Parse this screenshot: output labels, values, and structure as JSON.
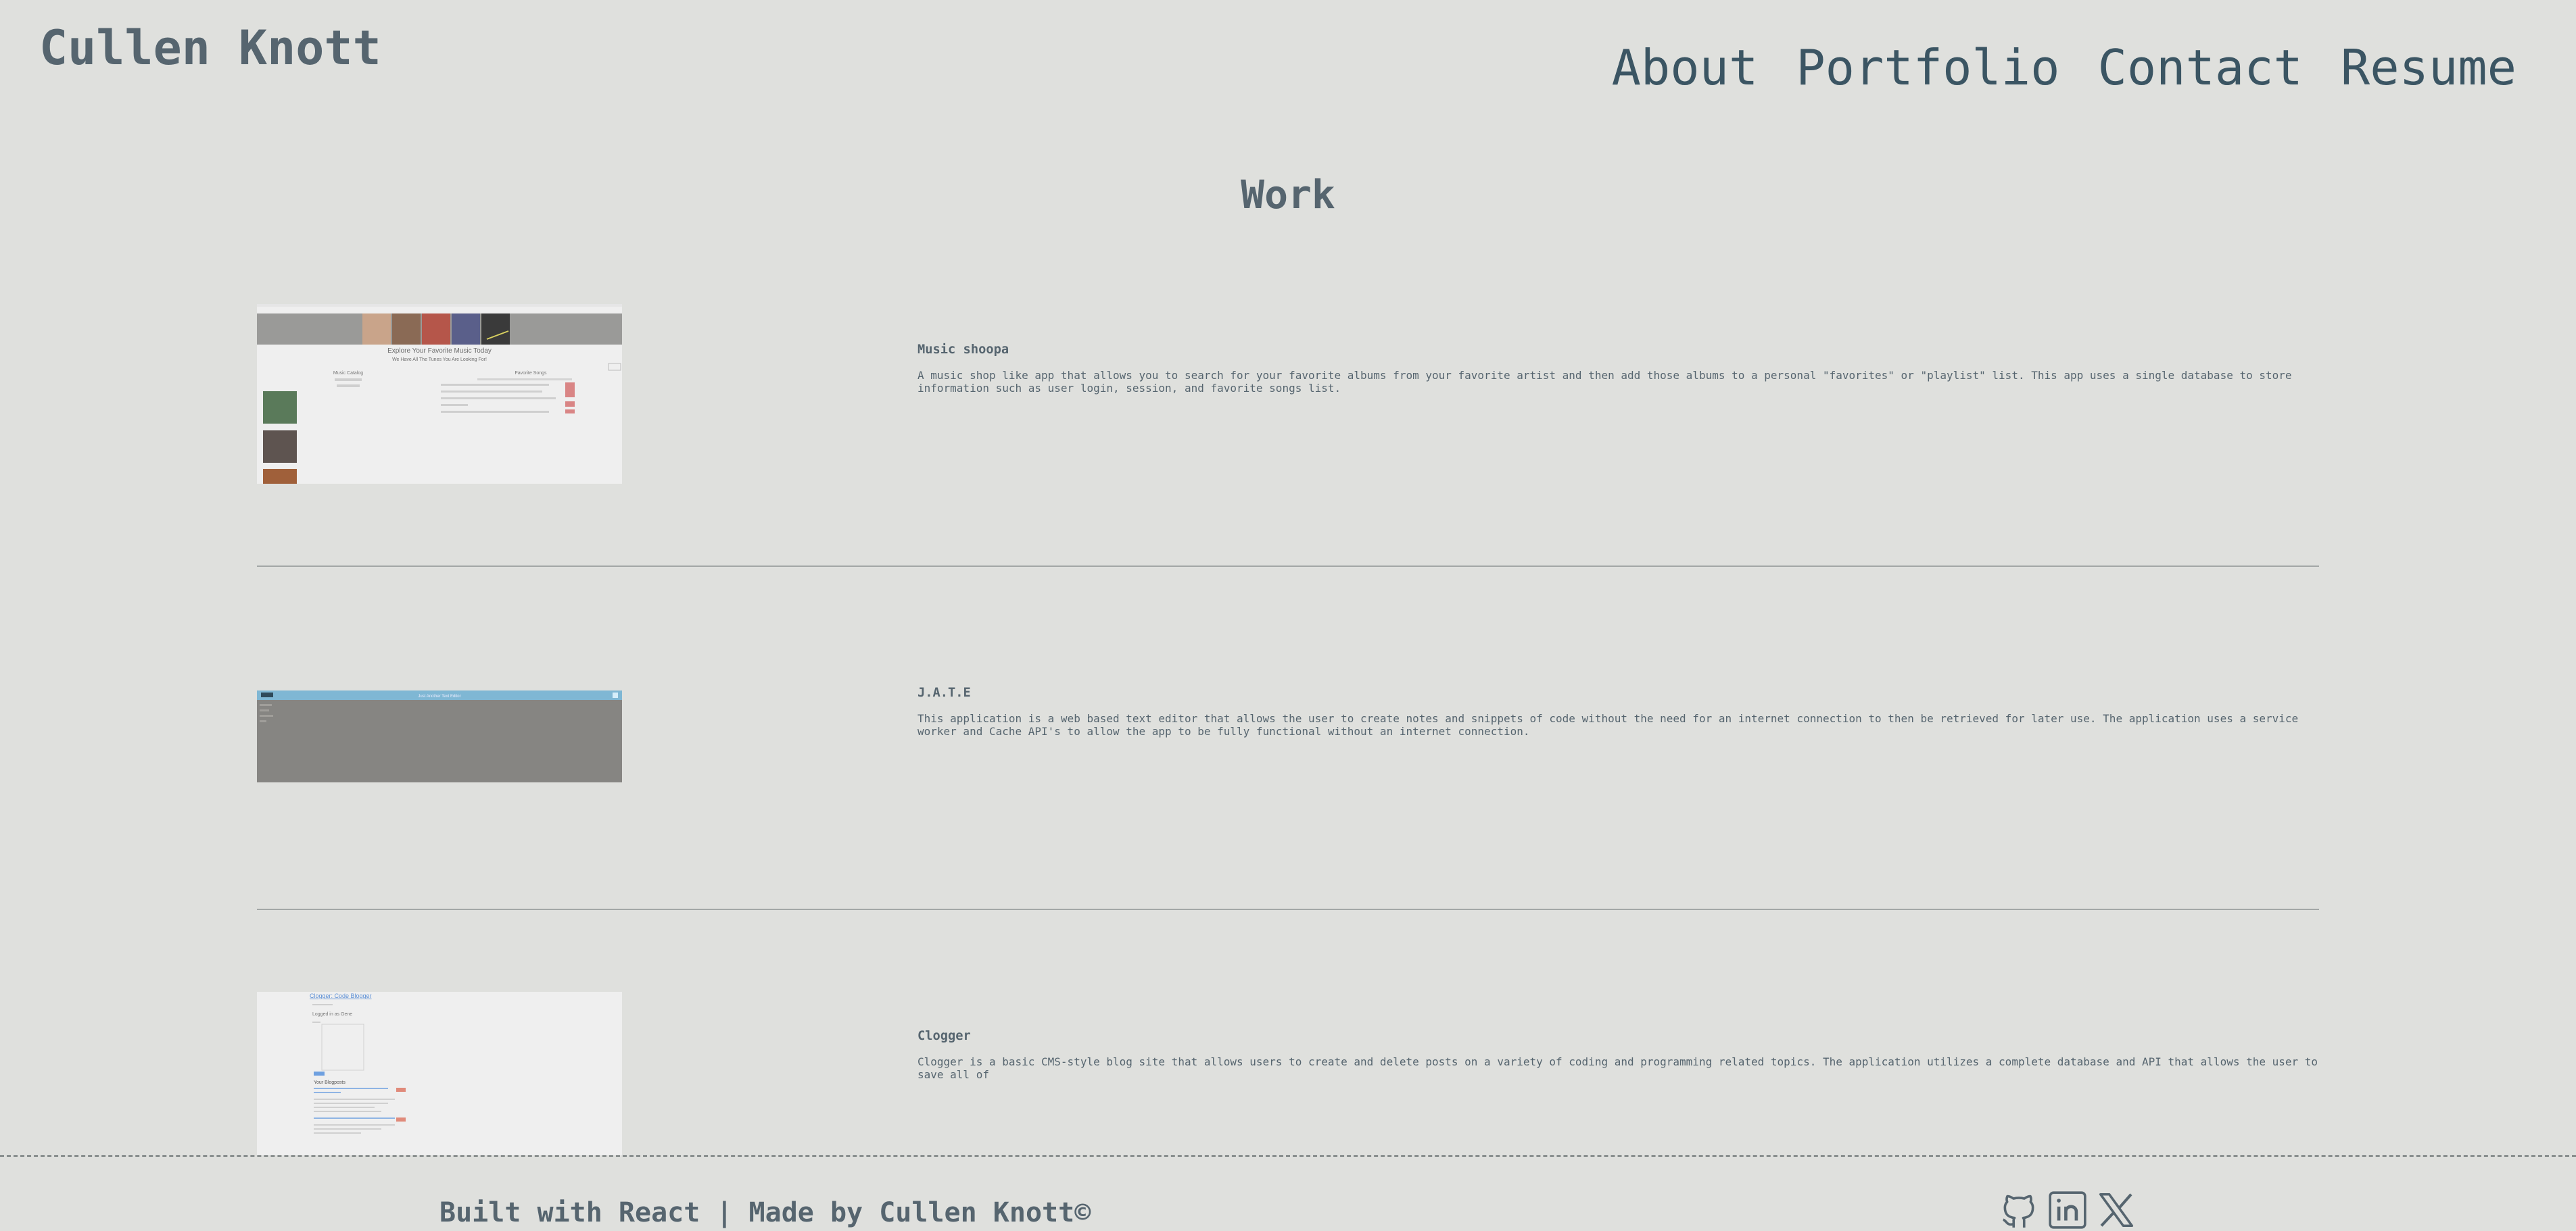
{
  "header": {
    "brand": "Cullen Knott",
    "nav": [
      "About",
      "Portfolio",
      "Contact",
      "Resume"
    ]
  },
  "section_title": "Work",
  "projects": [
    {
      "title": "Music shoopa",
      "description": "A music shop like app that allows you to search for your favorite albums from your favorite artist and then add those albums to a personal \"favorites\" or \"playlist\" list. This app uses a single database to store information such as user login, session, and favorite songs list.",
      "thumb": {
        "heading": "Explore Your Favorite Music Today",
        "subheading": "We Have All The Tunes You Are Looking For!",
        "col_left_title": "Music Catalog",
        "col_right_title": "Favorite Songs"
      }
    },
    {
      "title": "J.A.T.E",
      "description": "This application is a web based text editor that allows the user to create notes and snippets of code without the need for an internet connection to then be retrieved for later use. The application uses a service worker and Cache API's to allow the app to be fully functional without an internet connection.",
      "thumb": {
        "bar_text": "Just Another Text Editor"
      }
    },
    {
      "title": "Clogger",
      "description": "Clogger is a basic CMS-style blog site that allows users to create and delete posts on a variety of coding and programming related topics. The application utilizes a complete database and API that allows the user to save all of",
      "thumb": {
        "site_title": "Clogger: Code Blogger",
        "logged_in": "Logged in as Gene",
        "your_blogposts": "Your Blogposts"
      }
    }
  ],
  "footer": {
    "text": "Built with React | Made by Cullen Knott©",
    "social": [
      "github-icon",
      "linkedin-icon",
      "x-icon"
    ]
  },
  "colors": {
    "background": "#dfe0dd",
    "text": "#56656f",
    "nav": "#3b5563",
    "divider": "#a3a7a6"
  }
}
